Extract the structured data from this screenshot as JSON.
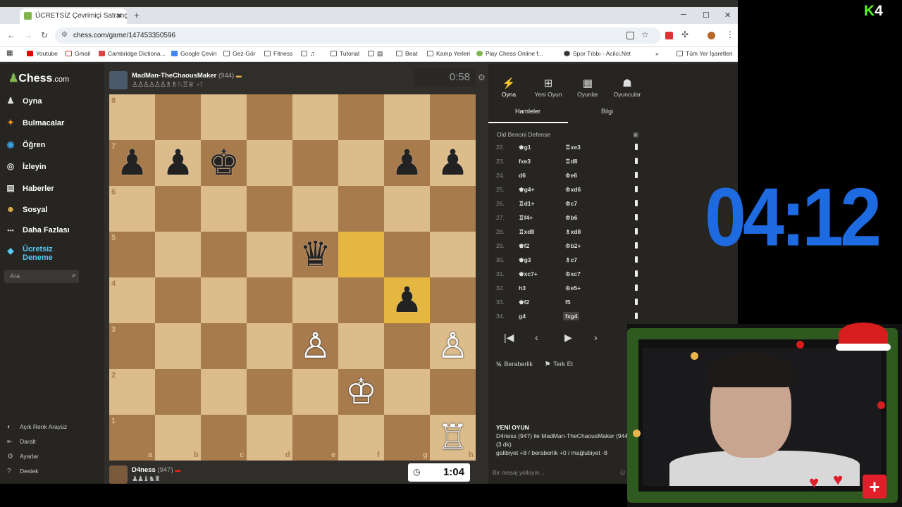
{
  "browser": {
    "tab_title": "ÜCRETSİZ Çevrimiçi Satranç Oy",
    "url": "chess.com/game/147453350596",
    "bookmarks": [
      "Youtube",
      "Gmail",
      "Cambridge Dictiona...",
      "Google Çeviri",
      "Gez-Gör",
      "Fitness",
      "",
      "Tutorial",
      "",
      "Beat",
      "Kamp Yerleri",
      "Play Chess Online f...",
      "Spor Tıbbı - Acilci.Net",
      "Tüm Yer İşaretleri"
    ]
  },
  "sidebar": {
    "logo": "Chess",
    "logo_suffix": ".com",
    "items": [
      {
        "label": "Oyna",
        "icon": "♟"
      },
      {
        "label": "Bulmacalar",
        "icon": "✦"
      },
      {
        "label": "Öğren",
        "icon": "◉"
      },
      {
        "label": "İzleyin",
        "icon": "◎"
      },
      {
        "label": "Haberler",
        "icon": "▤"
      },
      {
        "label": "Sosyal",
        "icon": "☻"
      },
      {
        "label": "Daha Fazlası",
        "icon": "•••"
      },
      {
        "label": "Ücretsiz Deneme",
        "icon": "◆"
      }
    ],
    "search_placeholder": "Ara",
    "bottom": [
      {
        "label": "Açık Renk Arayüz",
        "icon": "◐"
      },
      {
        "label": "Daralt",
        "icon": "⇤"
      },
      {
        "label": "Ayarlar",
        "icon": "⚙"
      },
      {
        "label": "Destek",
        "icon": "?"
      }
    ]
  },
  "top_player": {
    "name": "MadMan-TheChaousMaker",
    "rating": "(944)",
    "captured": "♙♙♙♙♙♙♗♗♘♖♕",
    "advantage": "+7",
    "clock": "0:58"
  },
  "bottom_player": {
    "name": "D4ness",
    "rating": "(947)",
    "captured": "♟♟♝♞♜",
    "clock": "1:04"
  },
  "board": {
    "ranks": [
      "8",
      "7",
      "6",
      "5",
      "4",
      "3",
      "2",
      "1"
    ],
    "files": [
      "a",
      "b",
      "c",
      "d",
      "e",
      "f",
      "g",
      "h"
    ],
    "highlight": [
      "f5",
      "g4"
    ],
    "pieces": [
      {
        "sq": "a7",
        "glyph": "♟",
        "color": "b"
      },
      {
        "sq": "b7",
        "glyph": "♟",
        "color": "b"
      },
      {
        "sq": "c7",
        "glyph": "♚",
        "color": "b"
      },
      {
        "sq": "g7",
        "glyph": "♟",
        "color": "b"
      },
      {
        "sq": "h7",
        "glyph": "♟",
        "color": "b"
      },
      {
        "sq": "e5",
        "glyph": "♛",
        "color": "b"
      },
      {
        "sq": "g4",
        "glyph": "♟",
        "color": "b"
      },
      {
        "sq": "e3",
        "glyph": "♙",
        "color": "w"
      },
      {
        "sq": "h3",
        "glyph": "♙",
        "color": "w"
      },
      {
        "sq": "f2",
        "glyph": "♔",
        "color": "w"
      },
      {
        "sq": "h1",
        "glyph": "♖",
        "color": "w"
      }
    ]
  },
  "right_panel": {
    "tabs": [
      {
        "label": "Oyna",
        "icon": "⚡"
      },
      {
        "label": "Yeni Oyun",
        "icon": "⊞"
      },
      {
        "label": "Oyunlar",
        "icon": "▦"
      },
      {
        "label": "Oyuncular",
        "icon": "☗"
      }
    ],
    "subtabs": [
      "Hamleler",
      "Bilgi"
    ],
    "opening": "Old Benoni Defense",
    "moves": [
      {
        "n": "22.",
        "w": "♚g1",
        "b": "♖xe3"
      },
      {
        "n": "23.",
        "w": "fxe3",
        "b": "♖d8"
      },
      {
        "n": "24.",
        "w": "d6",
        "b": "♔e6"
      },
      {
        "n": "25.",
        "w": "♚g4+",
        "b": "♔xd6"
      },
      {
        "n": "26.",
        "w": "♖d1+",
        "b": "♔c7"
      },
      {
        "n": "27.",
        "w": "♖f4+",
        "b": "♔b6"
      },
      {
        "n": "28.",
        "w": "♖xd8",
        "b": "♗xd8"
      },
      {
        "n": "29.",
        "w": "♚f2",
        "b": "♔b2+"
      },
      {
        "n": "30.",
        "w": "♚g3",
        "b": "♗c7"
      },
      {
        "n": "31.",
        "w": "♚xc7+",
        "b": "♔xc7"
      },
      {
        "n": "32.",
        "w": "h3",
        "b": "♔e5+"
      },
      {
        "n": "33.",
        "w": "♚f2",
        "b": "f5"
      },
      {
        "n": "34.",
        "w": "g4",
        "b": "fxg4"
      }
    ],
    "actions": [
      {
        "label": "Beraberlik",
        "icon": "½"
      },
      {
        "label": "Terk Et",
        "icon": "⚑"
      }
    ],
    "new_game_title": "YENİ OYUN",
    "new_game_line1": "D4ness (947) ile MadMan-TheChaousMaker (944)",
    "new_game_line2": "(3 dk)",
    "new_game_line3": "galibiyet +8 / beraberlik +0 / mağlubiyet -8",
    "chat_placeholder": "Bir mesaj yollayın..."
  },
  "overlay": {
    "kick_k": "K",
    "kick_num": "4",
    "timer": "04:12"
  }
}
